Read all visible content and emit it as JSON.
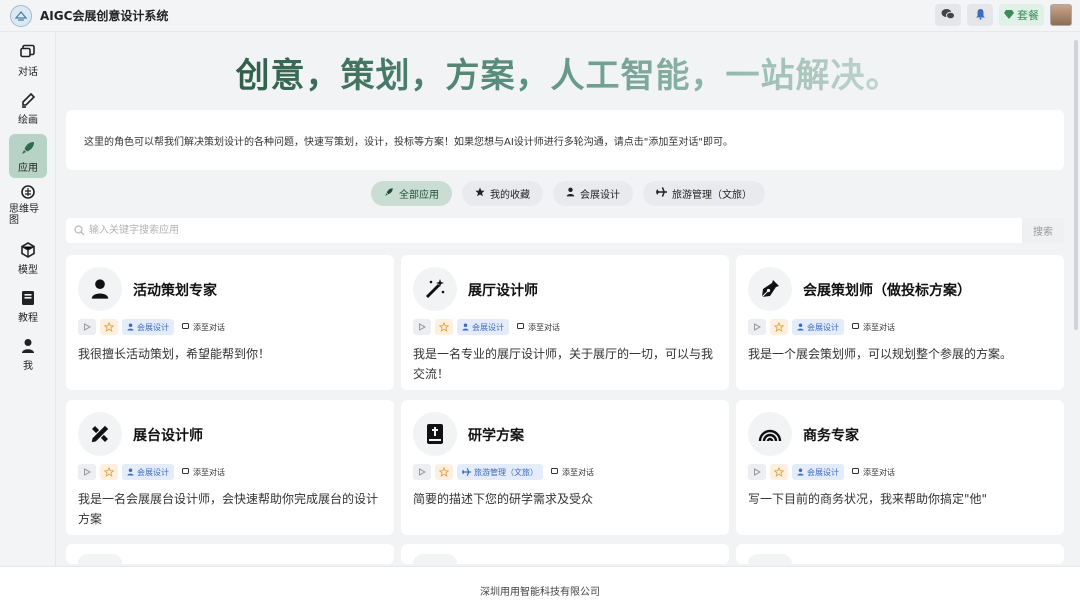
{
  "app": {
    "title": "AIGC会展创意设计系统"
  },
  "topbar": {
    "package_label": "套餐"
  },
  "sidebar": {
    "items": [
      {
        "label": "对话",
        "icon": "chat-icon"
      },
      {
        "label": "绘画",
        "icon": "brush-icon"
      },
      {
        "label": "应用",
        "icon": "rocket-icon",
        "active": true
      },
      {
        "label": "思维导图",
        "icon": "brain-icon"
      },
      {
        "label": "模型",
        "icon": "cube-icon"
      },
      {
        "label": "教程",
        "icon": "book-icon"
      },
      {
        "label": "我",
        "icon": "user-icon"
      }
    ]
  },
  "hero": {
    "title": "创意，策划，方案，人工智能，一站解决。"
  },
  "intro": {
    "text": "这里的角色可以帮我们解决策划设计的各种问题，快速写策划，设计，投标等方案！如果您想与AI设计师进行多轮沟通，请点击\"添加至对话\"即可。"
  },
  "tabs": [
    {
      "label": "全部应用",
      "icon": "rocket-icon",
      "active": true
    },
    {
      "label": "我的收藏",
      "icon": "star-icon"
    },
    {
      "label": "会展设计",
      "icon": "user-icon"
    },
    {
      "label": "旅游管理（文旅）",
      "icon": "plane-icon"
    }
  ],
  "search": {
    "placeholder": "输入关键字搜索应用",
    "button_label": "搜索"
  },
  "cards": [
    {
      "title": "活动策划专家",
      "icon": "person-icon",
      "category": "会展设计",
      "add_label": "添至对话",
      "desc": "我很擅长活动策划，希望能帮到你！"
    },
    {
      "title": "展厅设计师",
      "icon": "magic-wand-icon",
      "category": "会展设计",
      "add_label": "添至对话",
      "desc": "我是一名专业的展厅设计师，关于展厅的一切，可以与我交流！"
    },
    {
      "title": "会展策划师（做投标方案）",
      "icon": "pen-nib-icon",
      "category": "会展设计",
      "add_label": "添至对话",
      "desc": "我是一个展会策划师，可以规划整个参展的方案。"
    },
    {
      "title": "展台设计师",
      "icon": "pencil-ruler-icon",
      "category": "会展设计",
      "add_label": "添至对话",
      "desc": "我是一名会展展台设计师，会快速帮助你完成展台的设计方案"
    },
    {
      "title": "研学方案",
      "icon": "bible-icon",
      "category": "旅游管理（文旅）",
      "add_label": "添至对话",
      "desc": "简要的描述下您的研学需求及受众"
    },
    {
      "title": "商务专家",
      "icon": "rainbow-icon",
      "category": "会展设计",
      "add_label": "添至对话",
      "desc": "写一下目前的商务状况，我来帮助你搞定\"他\""
    }
  ],
  "footer": {
    "text": "深圳用用智能科技有限公司"
  },
  "colors": {
    "accent": "#2e6b4c",
    "active_bg": "#b7d3c5",
    "tag_blue": "#3d6bc2"
  }
}
